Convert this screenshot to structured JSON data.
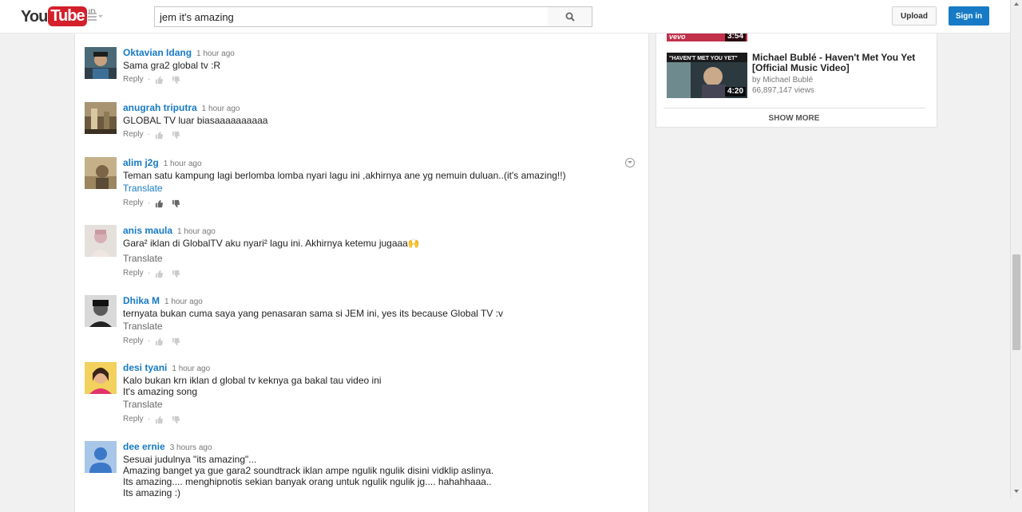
{
  "header": {
    "logo_you": "You",
    "logo_tube": "Tube",
    "logo_country": "ID",
    "search_value": "jem it's amazing",
    "upload_label": "Upload",
    "signin_label": "Sign in"
  },
  "comments": [
    {
      "author": "Oktavian Idang",
      "time": "1 hour ago",
      "lines": [
        "Sama gra2 global tv :R"
      ],
      "translate": "",
      "reply": "Reply"
    },
    {
      "author": "anugrah triputra",
      "time": "1 hour ago",
      "lines": [
        "GLOBAL TV luar biasaaaaaaaaaa"
      ],
      "translate": "",
      "reply": "Reply"
    },
    {
      "author": "alim j2g",
      "time": "1 hour ago",
      "lines": [
        "Teman satu kampung lagi berlomba lomba nyari lagu ini ,akhirnya ane yg nemuin duluan..(it's amazing!!)"
      ],
      "translate": "Translate",
      "reply": "Reply"
    },
    {
      "author": "anis maula",
      "time": "1 hour ago",
      "lines": [
        "Gara² iklan di GlobalTV aku nyari² lagu ini. Akhirnya ketemu jugaaa🙌"
      ],
      "translate": "Translate",
      "reply": "Reply"
    },
    {
      "author": "Dhika M",
      "time": "1 hour ago",
      "lines": [
        "ternyata bukan cuma saya yang penasaran sama si JEM ini, yes its because Global TV  :v"
      ],
      "translate": "Translate",
      "reply": "Reply"
    },
    {
      "author": "desi tyani",
      "time": "1 hour ago",
      "lines": [
        "Kalo bukan krn iklan d global tv keknya ga bakal tau video ini",
        "It's amazing song"
      ],
      "translate": "Translate",
      "reply": "Reply"
    },
    {
      "author": "dee ernie",
      "time": "3 hours ago",
      "lines": [
        "Sesuai judulnya \"its amazing\"...",
        "Amazing banget ya gue gara2 soundtrack iklan ampe ngulik ngulik disini vidklip aslinya.",
        "Its amazing.... menghipnotis sekian banyak orang untuk ngulik ngulik jg.... hahahhaaa..",
        "Its amazing :)"
      ],
      "translate": "",
      "reply": ""
    }
  ],
  "sidebar": {
    "prev_video_duration": "3:54",
    "prev_video_badge": "vevo",
    "video": {
      "title": "Michael Bublé - Haven't Met You Yet [Official Music Video]",
      "by": "by Michael Bublé",
      "views": "66,897,147 views",
      "duration": "4:20"
    },
    "show_more": "SHOW MORE"
  }
}
